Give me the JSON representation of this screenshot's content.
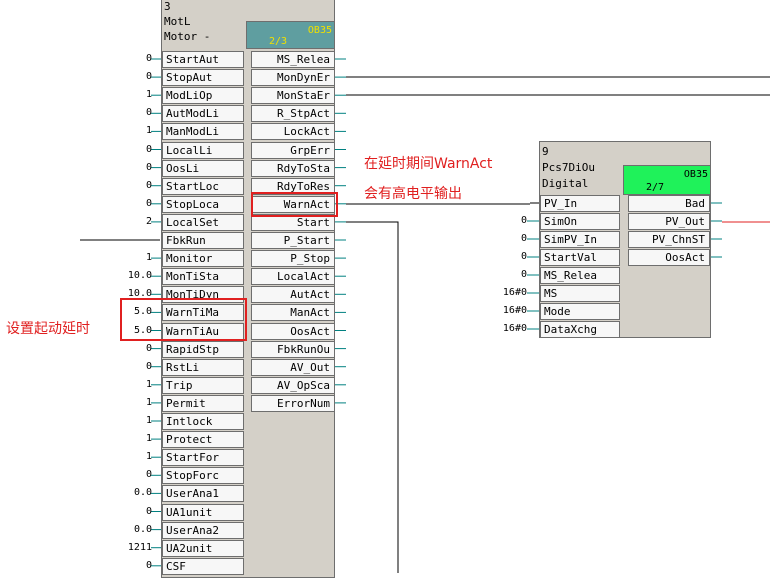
{
  "motor_block": {
    "number": "3",
    "type": "MotL",
    "comment": "Motor -",
    "ob_name": "OB35",
    "ob_position": "2/3",
    "inputs": [
      {
        "value": "0",
        "name": "StartAut"
      },
      {
        "value": "0",
        "name": "StopAut"
      },
      {
        "value": "1",
        "name": "ModLiOp"
      },
      {
        "value": "0",
        "name": "AutModLi"
      },
      {
        "value": "1",
        "name": "ManModLi"
      },
      {
        "value": "0",
        "name": "LocalLi"
      },
      {
        "value": "0",
        "name": "OosLi"
      },
      {
        "value": "0",
        "name": "StartLoc"
      },
      {
        "value": "0",
        "name": "StopLoca"
      },
      {
        "value": "2",
        "name": "LocalSet"
      },
      {
        "value": "",
        "name": "FbkRun"
      },
      {
        "value": "1",
        "name": "Monitor"
      },
      {
        "value": "10.0",
        "name": "MonTiSta"
      },
      {
        "value": "10.0",
        "name": "MonTiDyn"
      },
      {
        "value": "5.0",
        "name": "WarnTiMa"
      },
      {
        "value": "5.0",
        "name": "WarnTiAu"
      },
      {
        "value": "0",
        "name": "RapidStp"
      },
      {
        "value": "0",
        "name": "RstLi"
      },
      {
        "value": "1",
        "name": "Trip"
      },
      {
        "value": "1",
        "name": "Permit"
      },
      {
        "value": "1",
        "name": "Intlock"
      },
      {
        "value": "1",
        "name": "Protect"
      },
      {
        "value": "1",
        "name": "StartFor"
      },
      {
        "value": "0",
        "name": "StopForc"
      },
      {
        "value": "0.0",
        "name": "UserAna1"
      },
      {
        "value": "0",
        "name": "UA1unit"
      },
      {
        "value": "0.0",
        "name": "UserAna2"
      },
      {
        "value": "1211",
        "name": "UA2unit"
      },
      {
        "value": "0",
        "name": "CSF"
      }
    ],
    "outputs": [
      {
        "name": "MS_Relea"
      },
      {
        "name": "MonDynEr"
      },
      {
        "name": "MonStaEr"
      },
      {
        "name": "R_StpAct"
      },
      {
        "name": "LockAct"
      },
      {
        "name": "GrpErr"
      },
      {
        "name": "RdyToSta"
      },
      {
        "name": "RdyToRes"
      },
      {
        "name": "WarnAct"
      },
      {
        "name": "Start"
      },
      {
        "name": "P_Start"
      },
      {
        "name": "P_Stop"
      },
      {
        "name": "LocalAct"
      },
      {
        "name": "AutAct"
      },
      {
        "name": "ManAct"
      },
      {
        "name": "OosAct"
      },
      {
        "name": "FbkRunOu"
      },
      {
        "name": "AV_Out"
      },
      {
        "name": "AV_OpSca"
      },
      {
        "name": "ErrorNum"
      }
    ]
  },
  "di_block": {
    "number": "9",
    "type": "Pcs7DiOu",
    "comment": "Digital",
    "ob_name": "OB35",
    "ob_position": "2/7",
    "inputs": [
      {
        "value": "",
        "name": "PV_In"
      },
      {
        "value": "0",
        "name": "SimOn"
      },
      {
        "value": "0",
        "name": "SimPV_In"
      },
      {
        "value": "0",
        "name": "StartVal"
      },
      {
        "value": "0",
        "name": "MS_Relea"
      },
      {
        "value": "16#0",
        "name": "MS"
      },
      {
        "value": "16#0",
        "name": "Mode"
      },
      {
        "value": "16#0",
        "name": "DataXchg"
      }
    ],
    "outputs": [
      {
        "name": "Bad"
      },
      {
        "name": "PV_Out"
      },
      {
        "name": "PV_ChnST"
      },
      {
        "name": "OosAct"
      }
    ]
  },
  "annotations": {
    "warnact_note_line1": "在延时期间WarnAct",
    "warnact_note_line2": "会有高电平输出",
    "delay_note": "设置起动延时"
  },
  "colors": {
    "highlight": "#e02020",
    "ob35_motor_header": "#5f9ea0",
    "ob35_di_header": "#1ff25a",
    "ob_text_motor": "#f0e000",
    "wire_out_cyan": "#008080",
    "wire_red": "#e02020"
  }
}
